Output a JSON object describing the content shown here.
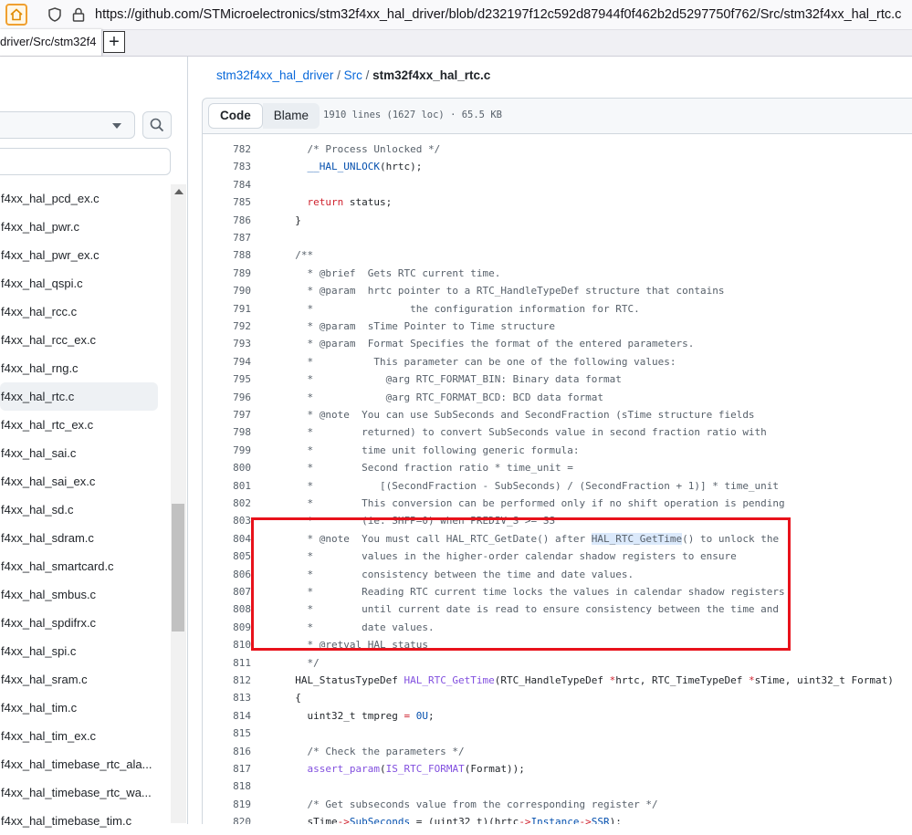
{
  "browser": {
    "url": "https://github.com/STMicroelectronics/stm32f4xx_hal_driver/blob/d232197f12c592d87944f0f462b2d5297750f762/Src/stm32f4xx_hal_rtc.c",
    "tab_title": "driver/Src/stm32f4",
    "new_tab_label": "+"
  },
  "sidebar": {
    "files": [
      "f4xx_hal_pcd_ex.c",
      "f4xx_hal_pwr.c",
      "f4xx_hal_pwr_ex.c",
      "f4xx_hal_qspi.c",
      "f4xx_hal_rcc.c",
      "f4xx_hal_rcc_ex.c",
      "f4xx_hal_rng.c",
      "f4xx_hal_rtc.c",
      "f4xx_hal_rtc_ex.c",
      "f4xx_hal_sai.c",
      "f4xx_hal_sai_ex.c",
      "f4xx_hal_sd.c",
      "f4xx_hal_sdram.c",
      "f4xx_hal_smartcard.c",
      "f4xx_hal_smbus.c",
      "f4xx_hal_spdifrx.c",
      "f4xx_hal_spi.c",
      "f4xx_hal_sram.c",
      "f4xx_hal_tim.c",
      "f4xx_hal_tim_ex.c",
      "f4xx_hal_timebase_rtc_ala...",
      "f4xx_hal_timebase_rtc_wa...",
      "f4xx_hal_timebase_tim.c"
    ],
    "active_file": "f4xx_hal_rtc.c"
  },
  "breadcrumb": {
    "repo": "stm32f4xx_hal_driver",
    "sep1": "/",
    "dir": "Src",
    "sep2": "/",
    "file": "stm32f4xx_hal_rtc.c"
  },
  "file_header": {
    "code_label": "Code",
    "blame_label": "Blame",
    "meta": "1910 lines (1627 loc) · 65.5 KB"
  },
  "code_lines": [
    {
      "n": "782",
      "t": "    /* Process Unlocked */"
    },
    {
      "n": "783",
      "t": "    __HAL_UNLOCK(hrtc);"
    },
    {
      "n": "784",
      "t": ""
    },
    {
      "n": "785",
      "t": "    return status;"
    },
    {
      "n": "786",
      "t": "  }"
    },
    {
      "n": "787",
      "t": ""
    },
    {
      "n": "788",
      "t": "  /**"
    },
    {
      "n": "789",
      "t": "    * @brief  Gets RTC current time."
    },
    {
      "n": "790",
      "t": "    * @param  hrtc pointer to a RTC_HandleTypeDef structure that contains"
    },
    {
      "n": "791",
      "t": "    *                the configuration information for RTC."
    },
    {
      "n": "792",
      "t": "    * @param  sTime Pointer to Time structure"
    },
    {
      "n": "793",
      "t": "    * @param  Format Specifies the format of the entered parameters."
    },
    {
      "n": "794",
      "t": "    *          This parameter can be one of the following values:"
    },
    {
      "n": "795",
      "t": "    *            @arg RTC_FORMAT_BIN: Binary data format"
    },
    {
      "n": "796",
      "t": "    *            @arg RTC_FORMAT_BCD: BCD data format"
    },
    {
      "n": "797",
      "t": "    * @note  You can use SubSeconds and SecondFraction (sTime structure fields"
    },
    {
      "n": "798",
      "t": "    *        returned) to convert SubSeconds value in second fraction ratio with"
    },
    {
      "n": "799",
      "t": "    *        time unit following generic formula:"
    },
    {
      "n": "800",
      "t": "    *        Second fraction ratio * time_unit ="
    },
    {
      "n": "801",
      "t": "    *           [(SecondFraction - SubSeconds) / (SecondFraction + 1)] * time_unit"
    },
    {
      "n": "802",
      "t": "    *        This conversion can be performed only if no shift operation is pending"
    },
    {
      "n": "803",
      "t": "    *        (ie. SHFP=0) when PREDIV_S >= SS"
    },
    {
      "n": "804",
      "t": "    * @note  You must call HAL_RTC_GetDate() after HAL_RTC_GetTime() to unlock the"
    },
    {
      "n": "805",
      "t": "    *        values in the higher-order calendar shadow registers to ensure"
    },
    {
      "n": "806",
      "t": "    *        consistency between the time and date values."
    },
    {
      "n": "807",
      "t": "    *        Reading RTC current time locks the values in calendar shadow registers"
    },
    {
      "n": "808",
      "t": "    *        until current date is read to ensure consistency between the time and"
    },
    {
      "n": "809",
      "t": "    *        date values."
    },
    {
      "n": "810",
      "t": "    * @retval HAL status"
    },
    {
      "n": "811",
      "t": "    */"
    },
    {
      "n": "812",
      "t": "  HAL_StatusTypeDef HAL_RTC_GetTime(RTC_HandleTypeDef *hrtc, RTC_TimeTypeDef *sTime, uint32_t Format)"
    },
    {
      "n": "813",
      "t": "  {"
    },
    {
      "n": "814",
      "t": "    uint32_t tmpreg = 0U;"
    },
    {
      "n": "815",
      "t": ""
    },
    {
      "n": "816",
      "t": "    /* Check the parameters */"
    },
    {
      "n": "817",
      "t": "    assert_param(IS_RTC_FORMAT(Format));"
    },
    {
      "n": "818",
      "t": ""
    },
    {
      "n": "819",
      "t": "    /* Get subseconds value from the corresponding register */"
    },
    {
      "n": "820",
      "t": "    sTime->SubSeconds = (uint32_t)(hrtc->Instance->SSR);"
    }
  ],
  "colors": {
    "highlight_box": "#e8121b",
    "link": "#0969da",
    "keyword": "#cf222e",
    "function": "#8250df",
    "comment": "#57606a"
  },
  "icons": [
    "home-icon",
    "shield-icon",
    "lock-icon",
    "search-icon",
    "chevron-down-icon",
    "scroll-up-icon"
  ]
}
